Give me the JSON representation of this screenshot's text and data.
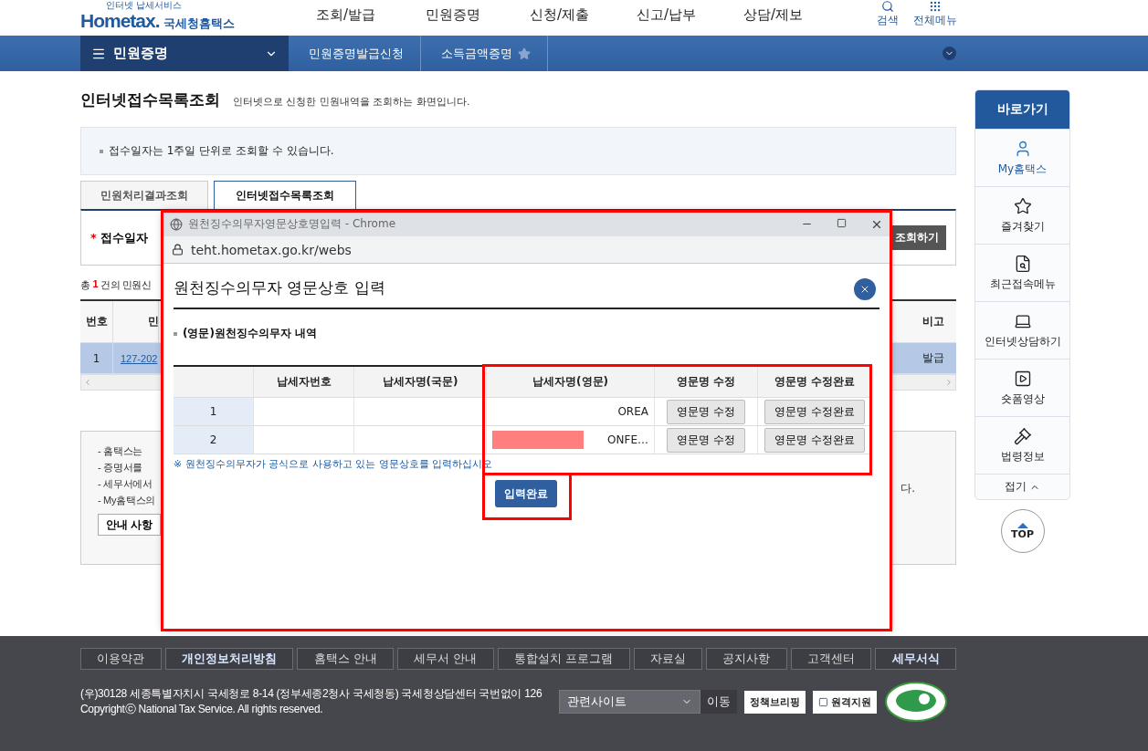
{
  "header": {
    "logo_tagline": "인터넷 납세서비스",
    "logo": "Hometax.",
    "agency": "국세청홈택스",
    "nav": [
      "조회/발급",
      "민원증명",
      "신청/제출",
      "신고/납부",
      "상담/제보"
    ],
    "utilities": [
      {
        "label": "검색",
        "kind": "search"
      },
      {
        "label": "전체메뉴",
        "kind": "grid"
      }
    ]
  },
  "menu_bar": {
    "current": "민원증명",
    "breadcrumbs": [
      "민원증명발급신청",
      "소득금액증명"
    ]
  },
  "page": {
    "title": "인터넷접수목록조회",
    "description": "인터넷으로 신청한 민원내역을 조회하는 화면입니다.",
    "notice": "접수일자는 1주일 단위로 조회할 수 있습니다.",
    "tabs": [
      {
        "label": "민원처리결과조회",
        "selected": false
      },
      {
        "label": "인터넷접수목록조회",
        "selected": true
      }
    ],
    "search": {
      "required_mark": "*",
      "label": "접수일자",
      "button": "조회하기"
    },
    "count": {
      "prefix": "총",
      "number": "1",
      "suffix": "건의 민원신"
    },
    "table": {
      "columns": [
        "번호",
        "민",
        "비고"
      ],
      "rows": [
        {
          "cells": [
            "1",
            "127-202",
            "발급"
          ],
          "selected": true
        }
      ]
    },
    "guide": {
      "lines": [
        "- 홈택스는",
        "- 증명서를",
        "- 세무서에서",
        "- My홈택스의"
      ],
      "tail": "다.",
      "button": "안내 사항"
    }
  },
  "popup": {
    "window_title": "원천징수의무자영문상호명입력 - Chrome",
    "url": "teht.hometax.go.kr/webs",
    "highlighted": true,
    "heading": "원천징수의무자 영문상호 입력",
    "section": "(영문)원천징수의무자 내역",
    "columns": [
      "납세자번호",
      "납세자명(국문)",
      "납세자명(영문)",
      "영문명 수정",
      "영문명 수정완료"
    ],
    "highlight_table": true,
    "rows": [
      {
        "number": "1",
        "name_en": "OREA",
        "redacted": false,
        "edit": "영문명 수정",
        "done": "영문명 수정완료"
      },
      {
        "number": "2",
        "name_en": "ONFE…",
        "redacted": true,
        "edit": "영문명 수정",
        "done": "영문명 수정완료"
      }
    ],
    "note": "※ 원천징수의무자가 공식으로 사용하고 있는 영문상호를 입력하십시오",
    "submit": "입력완료",
    "highlight_submit": true
  },
  "sidebar": {
    "title": "바로가기",
    "items": [
      {
        "label": "My홈택스",
        "kind": "user",
        "highlighted": true
      },
      {
        "label": "즐겨찾기",
        "kind": "star",
        "highlighted": false
      },
      {
        "label": "최근접속메뉴",
        "kind": "recent",
        "highlighted": false
      },
      {
        "label": "인터넷상담하기",
        "kind": "laptop",
        "highlighted": false
      },
      {
        "label": "숏폼영상",
        "kind": "video",
        "highlighted": false
      },
      {
        "label": "법령정보",
        "kind": "gavel",
        "highlighted": false
      }
    ],
    "fold": "접기",
    "top": "TOP"
  },
  "footer": {
    "links": [
      {
        "label": "이용약관",
        "bold": false
      },
      {
        "label": "개인정보처리방침",
        "bold": true
      },
      {
        "label": "홈택스 안내",
        "bold": false
      },
      {
        "label": "세무서 안내",
        "bold": false
      },
      {
        "label": "통합설치 프로그램",
        "bold": false
      },
      {
        "label": "자료실",
        "bold": false
      },
      {
        "label": "공지사항",
        "bold": false
      },
      {
        "label": "고객센터",
        "bold": false
      },
      {
        "label": "세무서식",
        "bold": true
      }
    ],
    "address": "(우)30128 세종특별자치시 국세청로 8-14 (정부세종2청사 국세청동) 국세청상담센터 국번없이 126",
    "copyright": "Copyrightⓒ National Tax Service. All rights reserved.",
    "site_select": "관련사이트",
    "go": "이동",
    "badges": [
      "정책브리핑",
      "원격지원"
    ]
  }
}
